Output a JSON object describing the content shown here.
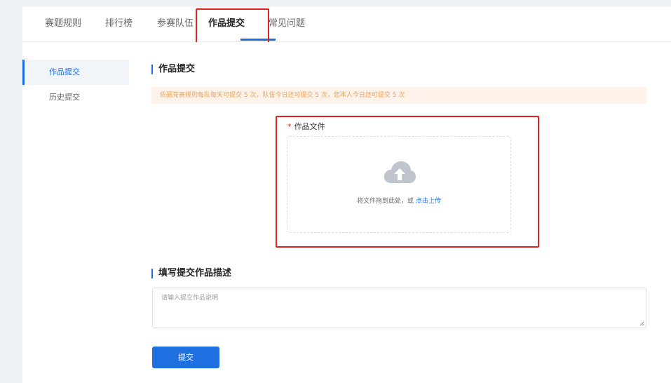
{
  "tabs": [
    {
      "label": "赛题规则"
    },
    {
      "label": "排行榜"
    },
    {
      "label": "参赛队伍"
    },
    {
      "label": "作品提交",
      "active": true
    },
    {
      "label": "常见问题"
    }
  ],
  "sidebar": {
    "items": [
      {
        "label": "作品提交",
        "active": true
      },
      {
        "label": "历史提交"
      }
    ]
  },
  "main": {
    "section_title": "作品提交",
    "notice": "依据竞赛规则每队每天可提交 5 次，队伍今日还可提交 5 次，您本人今日还可提交 5 次",
    "file_field": {
      "required_mark": "*",
      "label": "作品文件",
      "drop_text": "将文件拖到此处，或",
      "upload_link": "点击上传",
      "icon": "cloud-upload-icon"
    },
    "description_title": "填写提交作品描述",
    "description_placeholder": "请输入提交作品说明",
    "submit_label": "提交"
  },
  "colors": {
    "accent": "#1f6fe0",
    "highlight_border": "#e0231f",
    "notice_bg": "#fdf3ea",
    "notice_text": "#e9a25b",
    "page_bg": "#eef1f5"
  }
}
